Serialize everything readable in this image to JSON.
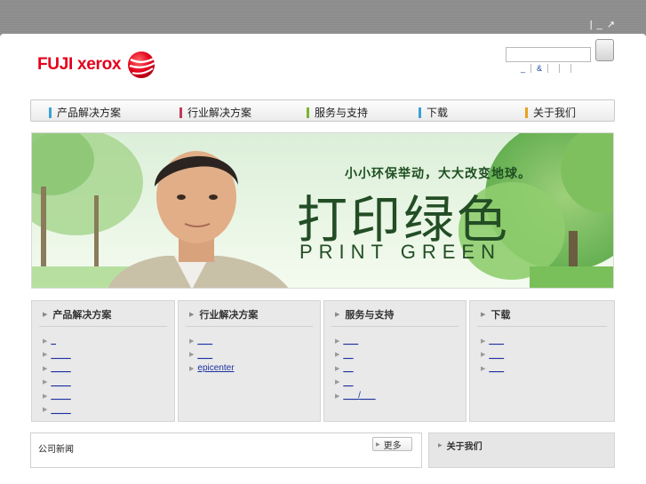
{
  "window": {
    "controls": "| _ ↗"
  },
  "brand": {
    "name_part1": "FUJI ",
    "name_part2": "xerox",
    "color": "#e4001b"
  },
  "search": {
    "placeholder": "",
    "value": ""
  },
  "util_links": [
    "_",
    "&",
    "",
    "",
    ""
  ],
  "nav": [
    {
      "label": "产品解决方案",
      "color": "#3aa2d8"
    },
    {
      "label": "行业解决方案",
      "color": "#c23a5a"
    },
    {
      "label": "服务与支持",
      "color": "#7bb52e"
    },
    {
      "label": "下载",
      "color": "#3aa2d8"
    },
    {
      "label": "关于我们",
      "color": "#e8a220"
    }
  ],
  "hero": {
    "slogan": "小小环保举动，大大改变地球。",
    "title": "打印绿色",
    "subtitle": "PRINT GREEN"
  },
  "panels": [
    {
      "title": "产品解决方案",
      "links": [
        "_",
        "____",
        "____",
        "____",
        "____",
        "____"
      ]
    },
    {
      "title": "行业解决方案",
      "links": [
        "___",
        "___",
        "epicenter"
      ]
    },
    {
      "title": "服务与支持",
      "links": [
        "___",
        "__",
        "__",
        "__",
        "___/___"
      ]
    },
    {
      "title": "下载",
      "links": [
        "___",
        "___",
        "___"
      ]
    }
  ],
  "news": {
    "title": "公司新闻",
    "more_label": "更多"
  },
  "about": {
    "title": "关于我们"
  }
}
